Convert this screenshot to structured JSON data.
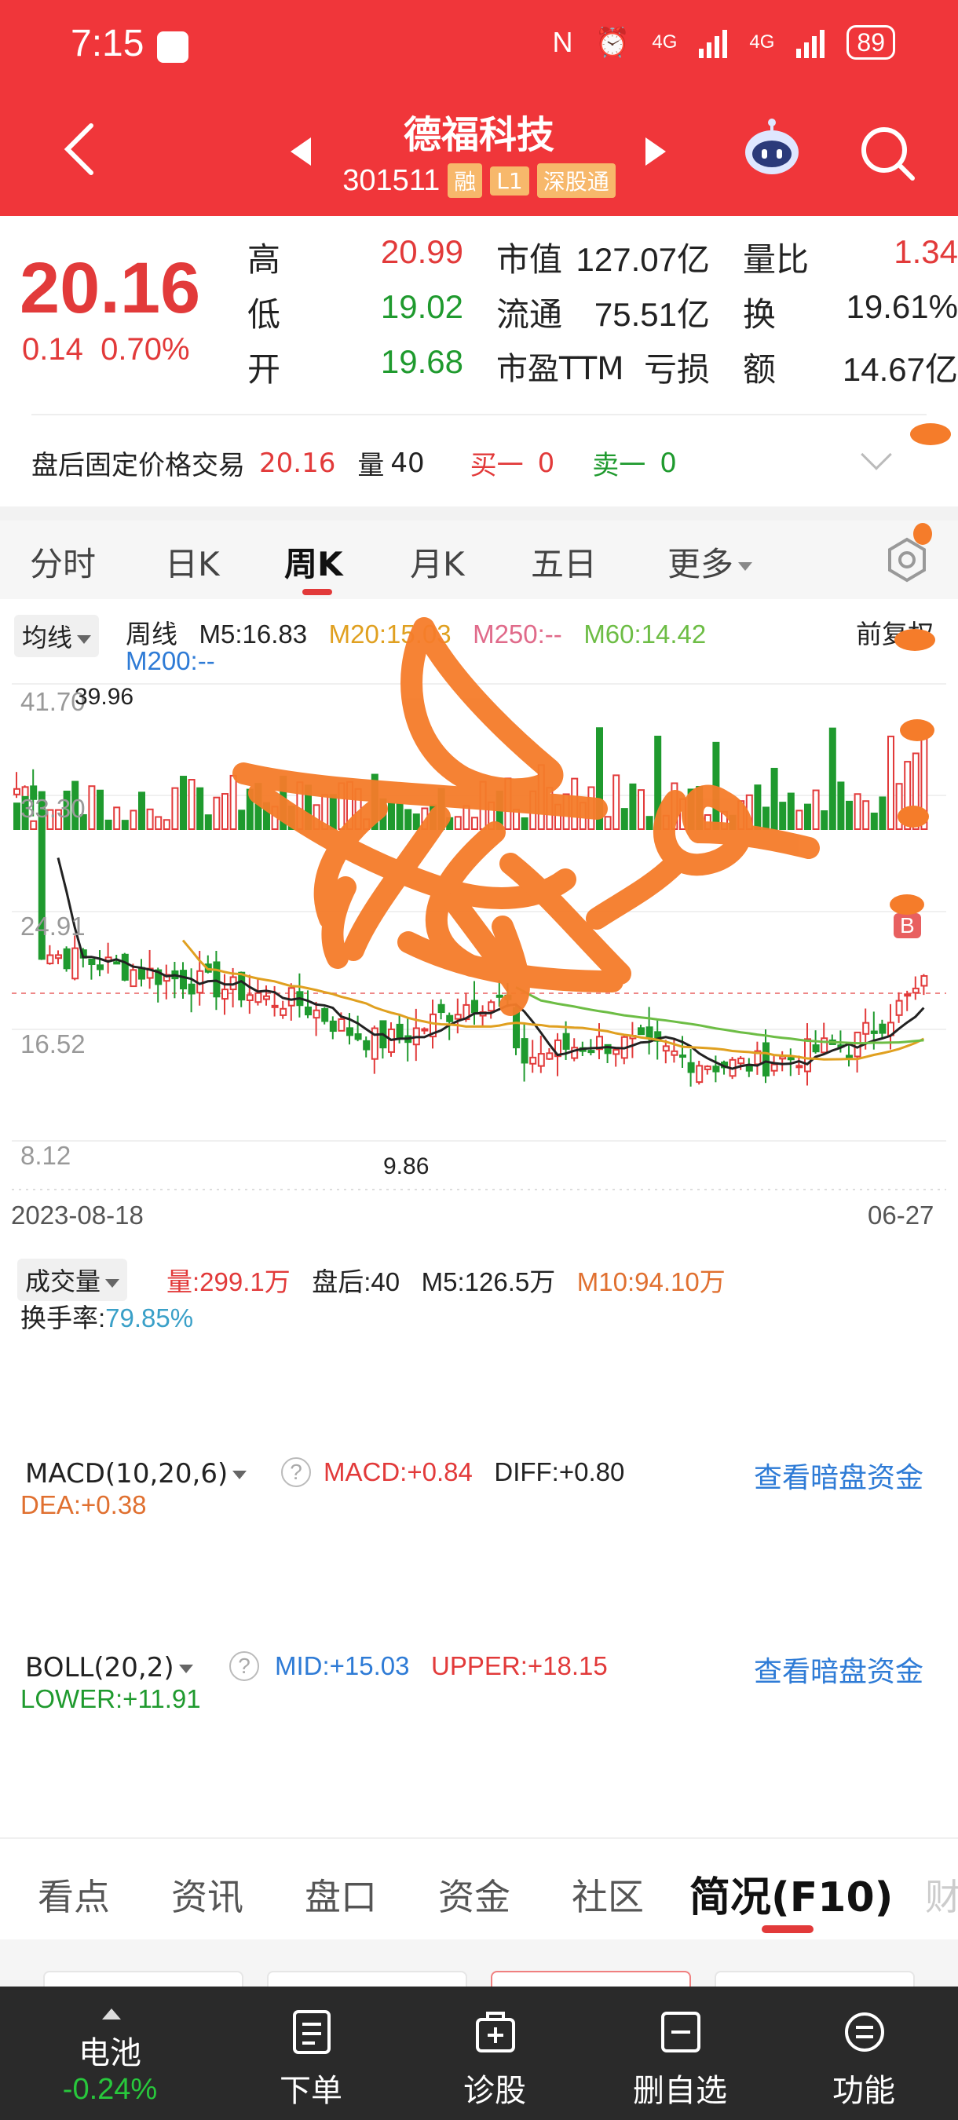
{
  "status_bar": {
    "time": "7:15",
    "network_1": "4G",
    "network_2": "4G",
    "battery": "89"
  },
  "header": {
    "title": "德福科技",
    "code": "301511",
    "tags": [
      "融",
      "L1",
      "深股通"
    ]
  },
  "quote": {
    "price": "20.16",
    "change": "0.14",
    "change_pct": "0.70%",
    "rows": [
      {
        "l1": "高",
        "v1": "20.99",
        "l2": "市值",
        "v2": "127.07亿",
        "l3": "量比",
        "v3": "1.34"
      },
      {
        "l1": "低",
        "v1": "19.02",
        "l2": "流通",
        "v2": "75.51亿",
        "l3": "换",
        "v3": "19.61%"
      },
      {
        "l1": "开",
        "v1": "19.68",
        "l2": "市盈TTM",
        "v2": "亏损",
        "l3": "额",
        "v3": "14.67亿"
      }
    ],
    "afterhours": {
      "label": "盘后固定价格交易",
      "price": "20.16",
      "vol_label": "量",
      "vol": "40",
      "buy1_label": "买一",
      "buy1": "0",
      "sell1_label": "卖一",
      "sell1": "0"
    }
  },
  "kline_tabs": [
    "分时",
    "日K",
    "周K",
    "月K",
    "五日",
    "更多"
  ],
  "kline": {
    "ma_select": "均线",
    "period": "周线",
    "m5": "M5:16.83",
    "m20": "M20:15.03",
    "m250": "M250:--",
    "m60": "M60:14.42",
    "m200": "M200:--",
    "adjust": "前复权",
    "y_labels": [
      "41.70",
      "33.30",
      "24.91",
      "16.52",
      "8.12"
    ],
    "high_marker": "39.96",
    "low_marker": "9.86",
    "buy_marker": "B",
    "date_start": "2023-08-18",
    "date_end": "06-27"
  },
  "volume": {
    "select": "成交量",
    "vol": "量:299.1万",
    "after": "盘后:40",
    "m5": "M5:126.5万",
    "m10": "M10:94.10万",
    "turnover_label": "换手率:",
    "turnover": "79.85%"
  },
  "macd": {
    "select": "MACD(10,20,6)",
    "macd": "MACD:+0.84",
    "diff": "DIFF:+0.80",
    "dea": "DEA:+0.38",
    "link": "查看暗盘资金"
  },
  "boll": {
    "select": "BOLL(20,2)",
    "mid": "MID:+15.03",
    "upper": "UPPER:+18.15",
    "lower": "LOWER:+11.91",
    "link": "查看暗盘资金"
  },
  "info_tabs": [
    "看点",
    "资讯",
    "盘口",
    "资金",
    "社区",
    "简况(F10)",
    "财"
  ],
  "bottom_bar": {
    "battery_label": "电池",
    "battery_change": "-0.24%",
    "items": [
      "下单",
      "诊股",
      "删自选",
      "功能"
    ]
  },
  "colors": {
    "header_red": "#f0363a",
    "rise": "#e23a3a",
    "fall": "#1f9a2e",
    "doodle": "#f57c2a"
  }
}
